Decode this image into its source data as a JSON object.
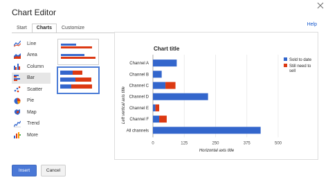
{
  "dialog": {
    "title": "Chart Editor",
    "help": "Help",
    "close_icon": "close-icon"
  },
  "tabs": [
    {
      "label": "Start"
    },
    {
      "label": "Charts",
      "active": true
    },
    {
      "label": "Customize"
    }
  ],
  "sidebar": {
    "items": [
      {
        "label": "Line",
        "icon": "line-chart-icon"
      },
      {
        "label": "Area",
        "icon": "area-chart-icon"
      },
      {
        "label": "Column",
        "icon": "column-chart-icon"
      },
      {
        "label": "Bar",
        "icon": "bar-chart-icon",
        "active": true
      },
      {
        "label": "Scatter",
        "icon": "scatter-chart-icon"
      },
      {
        "label": "Pie",
        "icon": "pie-chart-icon"
      },
      {
        "label": "Map",
        "icon": "map-icon"
      },
      {
        "label": "Trend",
        "icon": "trend-chart-icon"
      },
      {
        "label": "More",
        "icon": "more-icon"
      }
    ]
  },
  "colors": {
    "series1": "#3366cc",
    "series2": "#dc3912",
    "accent": "#4a78d6"
  },
  "buttons": {
    "insert": "Insert",
    "cancel": "Cancel"
  },
  "chart_data": {
    "type": "bar",
    "orientation": "horizontal",
    "title": "Chart title",
    "xlabel": "Horizontal axis title",
    "ylabel": "Left vertical axis title",
    "categories": [
      "Channel A",
      "Channel B",
      "Channel C",
      "Channel D",
      "Channel E",
      "Channel F",
      "All channels"
    ],
    "series": [
      {
        "name": "Sold to date",
        "values": [
          95,
          35,
          50,
          220,
          10,
          25,
          430
        ]
      },
      {
        "name": "Still need to sell",
        "values": [
          0,
          0,
          40,
          0,
          15,
          30,
          0
        ]
      }
    ],
    "stacked": true,
    "xlim": [
      0,
      500
    ],
    "xticks": [
      "0",
      "125",
      "250",
      "375",
      "500"
    ],
    "grid": true,
    "legend_position": "right"
  }
}
